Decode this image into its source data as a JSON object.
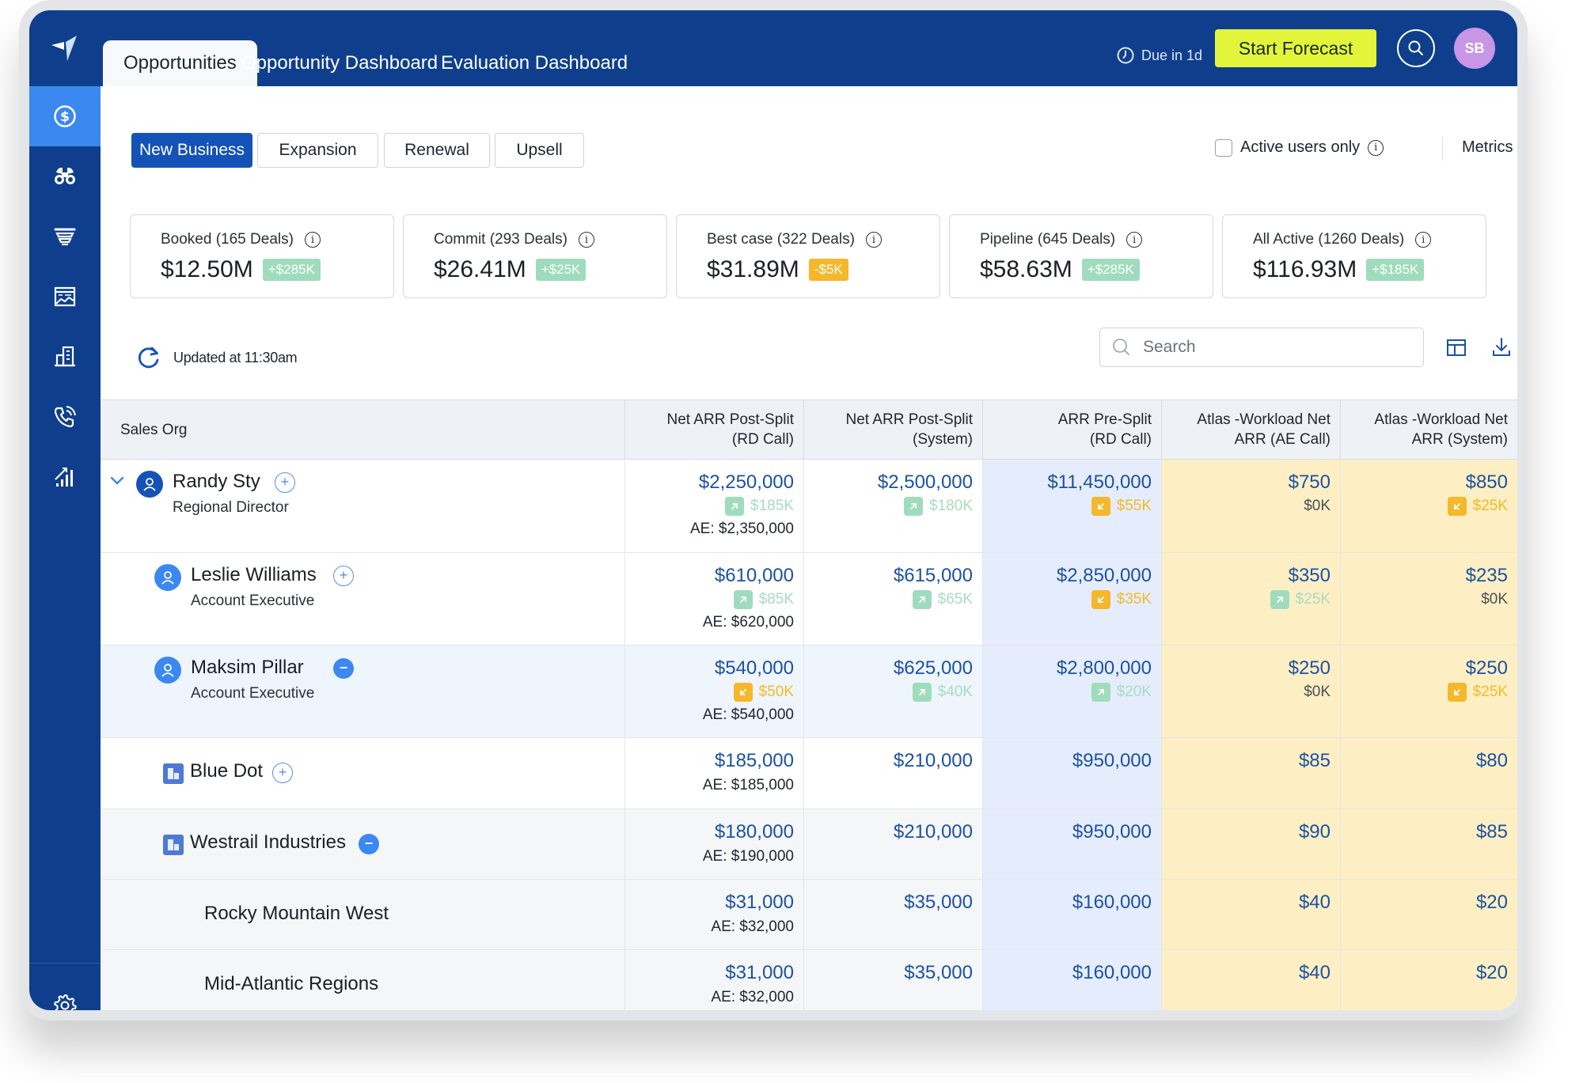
{
  "header": {
    "tabs": [
      {
        "label": "Opportunities",
        "active": true
      },
      {
        "label": "Opportunity Dashboard",
        "active": false
      },
      {
        "label": "Evaluation Dashboard",
        "active": false
      }
    ],
    "due_label": "Due in 1d",
    "start_forecast_label": "Start Forecast",
    "avatar_initials": "SB"
  },
  "sidebar": {
    "items": [
      {
        "icon": "dollar-circle-icon",
        "active": true
      },
      {
        "icon": "binoculars-icon",
        "active": false
      },
      {
        "icon": "funnel-icon",
        "active": false
      },
      {
        "icon": "chart-window-icon",
        "active": false
      },
      {
        "icon": "building-icon",
        "active": false
      },
      {
        "icon": "phone-call-icon",
        "active": false
      },
      {
        "icon": "signal-bars-icon",
        "active": false
      }
    ],
    "settings_icon": "gear-icon"
  },
  "filters": {
    "segments": [
      {
        "label": "New Business",
        "active": true
      },
      {
        "label": "Expansion",
        "active": false
      },
      {
        "label": "Renewal",
        "active": false
      },
      {
        "label": "Upsell",
        "active": false
      }
    ],
    "active_users_label": "Active users only",
    "active_users_checked": false,
    "metrics_label": "Metrics",
    "metrics_on": true
  },
  "kpis": [
    {
      "label": "Booked (165 Deals)",
      "value": "$12.50M",
      "delta": "+$285K",
      "direction": "up"
    },
    {
      "label": "Commit (293 Deals)",
      "value": "$26.41M",
      "delta": "+$25K",
      "direction": "up"
    },
    {
      "label": "Best case (322 Deals)",
      "value": "$31.89M",
      "delta": "-$5K",
      "direction": "down"
    },
    {
      "label": "Pipeline (645 Deals)",
      "value": "$58.63M",
      "delta": "+$285K",
      "direction": "up"
    },
    {
      "label": "All Active (1260 Deals)",
      "value": "$116.93M",
      "delta": "+$185K",
      "direction": "up"
    }
  ],
  "toolbar": {
    "updated_label": "Updated at 11:30am",
    "search_placeholder": "Search"
  },
  "table": {
    "columns": [
      {
        "label": "Sales Org"
      },
      {
        "line1": "Net ARR Post-Split",
        "line2": "(RD Call)"
      },
      {
        "line1": "Net ARR Post-Split",
        "line2": "(System)"
      },
      {
        "line1": "ARR Pre-Split",
        "line2": "(RD Call)"
      },
      {
        "line1": "Atlas -Workload Net",
        "line2": "ARR (AE Call)"
      },
      {
        "line1": "Atlas -Workload Net",
        "line2": "ARR (System)"
      }
    ],
    "rows": [
      {
        "name": "Randy Sty",
        "role": "Regional Director",
        "type": "person",
        "action": "plus",
        "cells": [
          {
            "value": "$2,250,000",
            "delta": "$185K",
            "dir": "up",
            "ae": "AE: $2,350,000"
          },
          {
            "value": "$2,500,000",
            "delta": "$180K",
            "dir": "up"
          },
          {
            "value": "$11,450,000",
            "delta": "$55K",
            "dir": "down"
          },
          {
            "value": "$750",
            "delta": "$0K",
            "dir": "neutral"
          },
          {
            "value": "$850",
            "delta": "$25K",
            "dir": "down"
          }
        ]
      },
      {
        "name": "Leslie Williams",
        "role": "Account Executive",
        "type": "person",
        "action": "plus",
        "cells": [
          {
            "value": "$610,000",
            "delta": "$85K",
            "dir": "up",
            "ae": "AE: $620,000"
          },
          {
            "value": "$615,000",
            "delta": "$65K",
            "dir": "up"
          },
          {
            "value": "$2,850,000",
            "delta": "$35K",
            "dir": "down"
          },
          {
            "value": "$350",
            "delta": "$25K",
            "dir": "up"
          },
          {
            "value": "$235",
            "delta": "$0K",
            "dir": "neutral"
          }
        ]
      },
      {
        "name": "Maksim Pillar",
        "role": "Account Executive",
        "type": "person",
        "action": "minus",
        "cells": [
          {
            "value": "$540,000",
            "delta": "$50K",
            "dir": "down",
            "ae": "AE: $540,000"
          },
          {
            "value": "$625,000",
            "delta": "$40K",
            "dir": "up"
          },
          {
            "value": "$2,800,000",
            "delta": "$20K",
            "dir": "up"
          },
          {
            "value": "$250",
            "delta": "$0K",
            "dir": "neutral"
          },
          {
            "value": "$250",
            "delta": "$25K",
            "dir": "down"
          }
        ]
      },
      {
        "name": "Blue Dot",
        "type": "org",
        "action": "plus",
        "cells": [
          {
            "value": "$185,000",
            "ae": "AE: $185,000"
          },
          {
            "value": "$210,000"
          },
          {
            "value": "$950,000"
          },
          {
            "value": "$85"
          },
          {
            "value": "$80"
          }
        ]
      },
      {
        "name": "Westrail Industries",
        "type": "org",
        "action": "minus",
        "cells": [
          {
            "value": "$180,000",
            "ae": "AE: $190,000"
          },
          {
            "value": "$210,000"
          },
          {
            "value": "$950,000"
          },
          {
            "value": "$90"
          },
          {
            "value": "$85"
          }
        ]
      },
      {
        "name": "Rocky Mountain West",
        "type": "region",
        "cells": [
          {
            "value": "$31,000",
            "ae": "AE: $32,000"
          },
          {
            "value": "$35,000"
          },
          {
            "value": "$160,000"
          },
          {
            "value": "$40"
          },
          {
            "value": "$20"
          }
        ]
      },
      {
        "name": "Mid-Atlantic Regions",
        "type": "region",
        "cells": [
          {
            "value": "$31,000",
            "ae": "AE: $32,000"
          },
          {
            "value": "$35,000"
          },
          {
            "value": "$160,000"
          },
          {
            "value": "$40"
          },
          {
            "value": "$20"
          }
        ]
      }
    ]
  },
  "colors": {
    "brand_navy": "#0f3f8c",
    "accent_blue": "#3b88f0",
    "start_forecast": "#e2f53a",
    "positive": "#9fdcbd",
    "negative": "#f5b72b",
    "value_text": "#1c52a3"
  }
}
